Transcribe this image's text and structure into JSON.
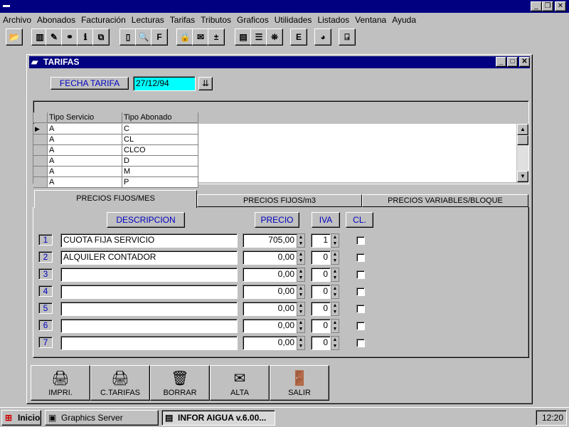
{
  "app": {
    "title": "",
    "buttons": {
      "minimize": "_",
      "restore": "❐",
      "close": "✕"
    }
  },
  "menu": [
    "Archivo",
    "Abonados",
    "Facturación",
    "Lecturas",
    "Tarifas",
    "Tributos",
    "Graficos",
    "Utilidades",
    "Listados",
    "Ventana",
    "Ayuda"
  ],
  "toolbar": [
    "open-folder",
    "abonados",
    "brush",
    "connections",
    "info",
    "copy-pages",
    "new-document",
    "print-preview",
    "font",
    "lock",
    "mail",
    "add-subtract",
    "page-b",
    "table",
    "binoculars",
    "export",
    "chart",
    "exit-door"
  ],
  "window": {
    "title": "TARIFAS",
    "fecha_label": "FECHA TARIFA",
    "fecha_value": "27/12/94"
  },
  "grid": {
    "headers": [
      "Tipo Servicio",
      "Tipo Abonado"
    ],
    "rows": [
      [
        "A",
        "C"
      ],
      [
        "A",
        "CL"
      ],
      [
        "A",
        "CLCO"
      ],
      [
        "A",
        "D"
      ],
      [
        "A",
        "M"
      ],
      [
        "A",
        "P"
      ]
    ]
  },
  "tabs": [
    "PRECIOS FIJOS/MES",
    "PRECIOS FIJOS/m3",
    "PRECIOS VARIABLES/BLOQUE"
  ],
  "form": {
    "headers": {
      "descripcion": "DESCRIPCION",
      "precio": "PRECIO",
      "iva": "IVA",
      "cl": "CL."
    },
    "rows": [
      {
        "n": "1",
        "desc": "CUOTA FIJA SERVICIO",
        "precio": "705,00",
        "iva": "1",
        "cl": false
      },
      {
        "n": "2",
        "desc": "ALQUILER CONTADOR",
        "precio": "0,00",
        "iva": "0",
        "cl": false
      },
      {
        "n": "3",
        "desc": "",
        "precio": "0,00",
        "iva": "0",
        "cl": false
      },
      {
        "n": "4",
        "desc": "",
        "precio": "0,00",
        "iva": "0",
        "cl": false
      },
      {
        "n": "5",
        "desc": "",
        "precio": "0,00",
        "iva": "0",
        "cl": false
      },
      {
        "n": "6",
        "desc": "",
        "precio": "0,00",
        "iva": "0",
        "cl": false
      },
      {
        "n": "7",
        "desc": "",
        "precio": "0,00",
        "iva": "0",
        "cl": false
      }
    ]
  },
  "buttons": [
    "IMPRI.",
    "C.TARIFAS",
    "BORRAR",
    "ALTA",
    "SALIR"
  ],
  "taskbar": {
    "start": "Inicio",
    "tasks": [
      "Graphics Server",
      "INFOR AIGUA v.6.00..."
    ],
    "clock": "12:20"
  }
}
